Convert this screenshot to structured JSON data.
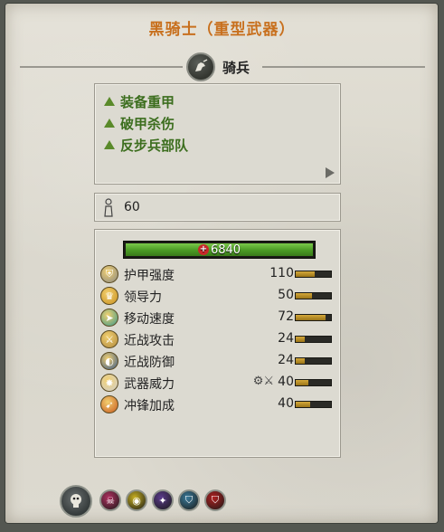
{
  "unit": {
    "title": "黑骑士（重型武器）",
    "class_label": "骑兵"
  },
  "attributes": [
    {
      "label": "装备重甲"
    },
    {
      "label": "破甲杀伤"
    },
    {
      "label": "反步兵部队"
    }
  ],
  "men": {
    "value": "60"
  },
  "health": {
    "value": "6840",
    "fraction": 1.0,
    "color": "#4a9a24"
  },
  "stats": [
    {
      "label": "护甲强度",
      "value": "110",
      "fraction": 0.55,
      "icon": "armour-icon",
      "icon_color": "#8a8a86"
    },
    {
      "label": "领导力",
      "value": "50",
      "fraction": 0.45,
      "icon": "leadership-icon",
      "icon_color": "#c89020"
    },
    {
      "label": "移动速度",
      "value": "72",
      "fraction": 0.85,
      "icon": "speed-icon",
      "icon_color": "#3a9a8a"
    },
    {
      "label": "近战攻击",
      "value": "24",
      "fraction": 0.25,
      "icon": "melee-attack-icon",
      "icon_color": "#b08a40"
    },
    {
      "label": "近战防御",
      "value": "24",
      "fraction": 0.25,
      "icon": "melee-defence-icon",
      "icon_color": "#3a5a8a"
    },
    {
      "label": "武器威力",
      "value": "40",
      "fraction": 0.35,
      "icon": "weapon-strength-icon",
      "icon_color": "#d0d0d0"
    },
    {
      "label": "冲锋加成",
      "value": "40",
      "fraction": 0.4,
      "icon": "charge-bonus-icon",
      "icon_color": "#c85a20"
    }
  ],
  "abilities": [
    {
      "icon": "skull-icon",
      "color": "#b03060"
    },
    {
      "icon": "eye-icon",
      "color": "#c8b020"
    },
    {
      "icon": "flame-icon",
      "color": "#5a3a8a"
    },
    {
      "icon": "shield-icon",
      "color": "#3a7a9a"
    },
    {
      "icon": "shield-red-icon",
      "color": "#b02020"
    }
  ],
  "colors": {
    "title": "#c8701e",
    "attribute": "#3c6e1e",
    "health": "#4a9a24",
    "stat_bar": "#d4a83a"
  }
}
